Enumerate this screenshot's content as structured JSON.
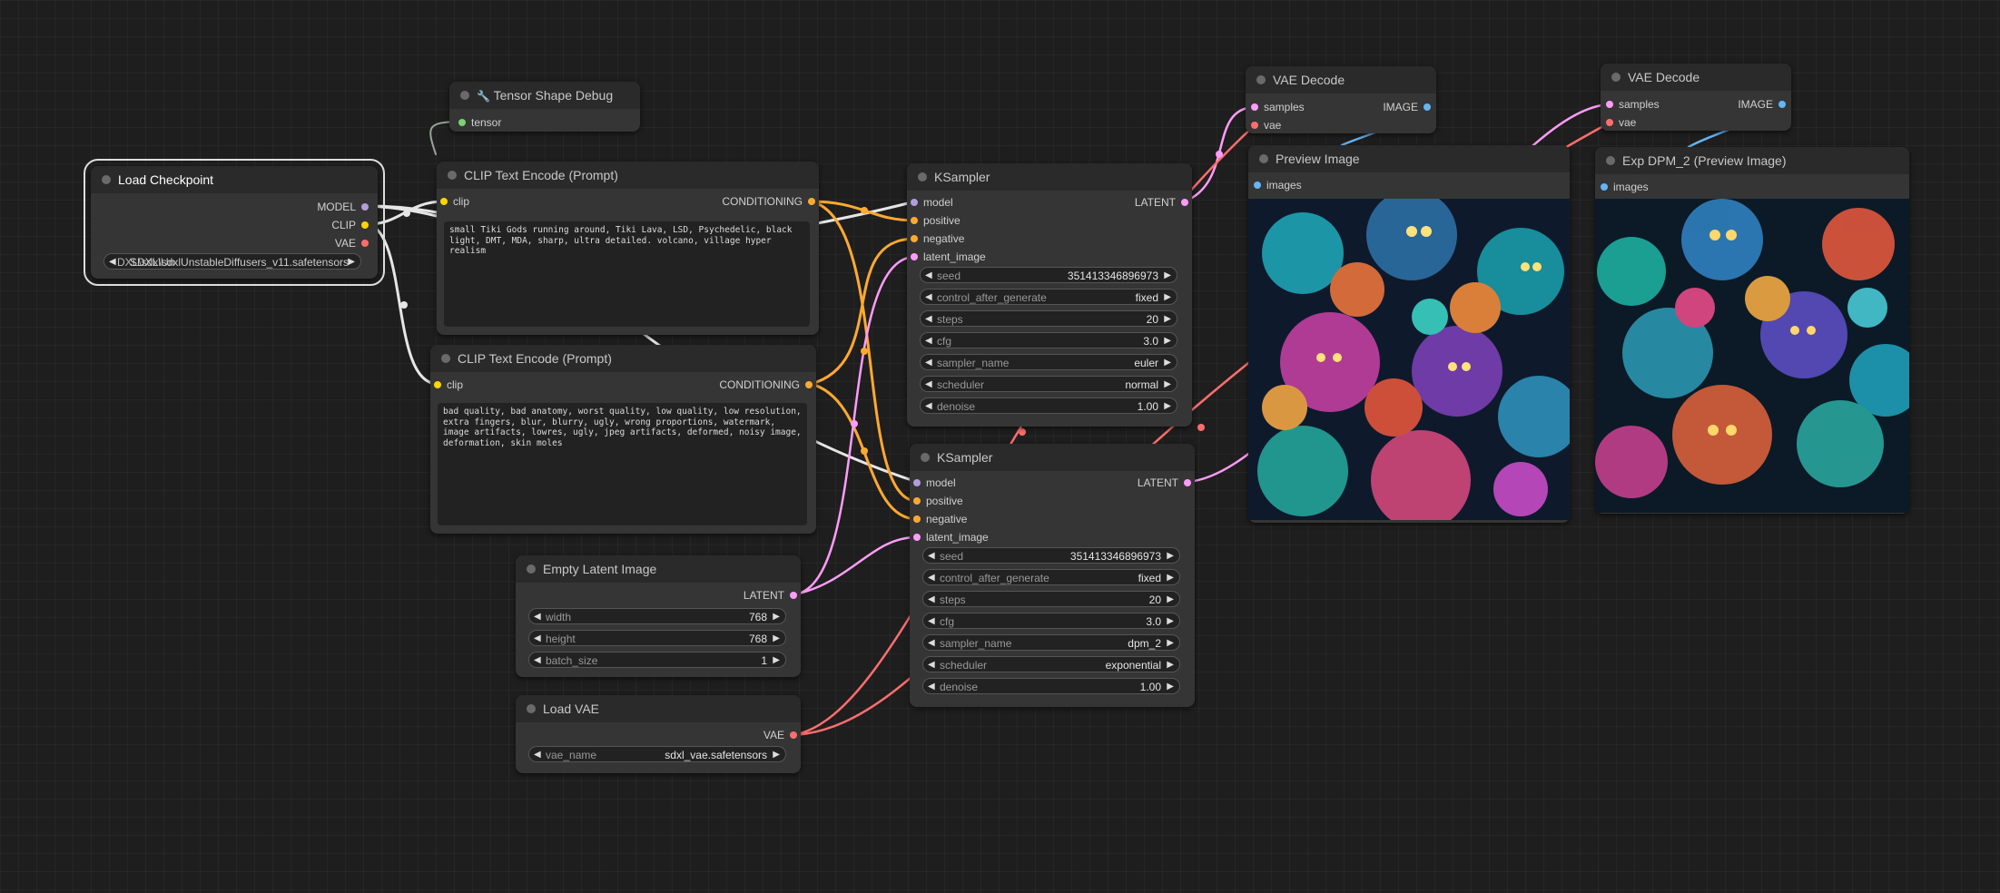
{
  "colors": {
    "model": "#b39ddb",
    "clip": "#ffd500",
    "vae": "#ff6e6e",
    "conditioning": "#ffa931",
    "latent": "#ff9cf9",
    "image": "#64b5f6",
    "tensor": "#7bd173"
  },
  "load_checkpoint": {
    "title": "Load Checkpoint",
    "outputs": [
      "MODEL",
      "CLIP",
      "VAE"
    ],
    "ckpt_name": "SDXL\\sdxlUnstableDiffusers_v11.safetensors",
    "ckpt_overlap": "DXL\\sdxlUn"
  },
  "tensor_debug": {
    "title": "Tensor Shape Debug",
    "icon": "wrench-icon",
    "input": "tensor"
  },
  "clip_pos": {
    "title": "CLIP Text Encode (Prompt)",
    "input": "clip",
    "output": "CONDITIONING",
    "text": "small Tiki Gods running around, Tiki Lava, LSD, Psychedelic, black light, DMT, MDA, sharp, ultra detailed. volcano, village hyper realism"
  },
  "clip_neg": {
    "title": "CLIP Text Encode (Prompt)",
    "input": "clip",
    "output": "CONDITIONING",
    "text": "bad quality, bad anatomy, worst quality, low quality, low resolution, extra fingers, blur, blurry, ugly, wrong proportions, watermark, image artifacts, lowres, ugly, jpeg artifacts, deformed, noisy image, deformation, skin moles"
  },
  "empty_latent": {
    "title": "Empty Latent Image",
    "output": "LATENT",
    "widgets": [
      {
        "label": "width",
        "value": "768"
      },
      {
        "label": "height",
        "value": "768"
      },
      {
        "label": "batch_size",
        "value": "1"
      }
    ]
  },
  "load_vae": {
    "title": "Load VAE",
    "output": "VAE",
    "widgets": [
      {
        "label": "vae_name",
        "value": "sdxl_vae.safetensors"
      }
    ]
  },
  "ksampler1": {
    "title": "KSampler",
    "inputs": [
      "model",
      "positive",
      "negative",
      "latent_image"
    ],
    "output": "LATENT",
    "widgets": [
      {
        "label": "seed",
        "value": "351413346896973"
      },
      {
        "label": "control_after_generate",
        "value": "fixed"
      },
      {
        "label": "steps",
        "value": "20"
      },
      {
        "label": "cfg",
        "value": "3.0"
      },
      {
        "label": "sampler_name",
        "value": "euler"
      },
      {
        "label": "scheduler",
        "value": "normal"
      },
      {
        "label": "denoise",
        "value": "1.00"
      }
    ]
  },
  "ksampler2": {
    "title": "KSampler",
    "inputs": [
      "model",
      "positive",
      "negative",
      "latent_image"
    ],
    "output": "LATENT",
    "widgets": [
      {
        "label": "seed",
        "value": "351413346896973"
      },
      {
        "label": "control_after_generate",
        "value": "fixed"
      },
      {
        "label": "steps",
        "value": "20"
      },
      {
        "label": "cfg",
        "value": "3.0"
      },
      {
        "label": "sampler_name",
        "value": "dpm_2"
      },
      {
        "label": "scheduler",
        "value": "exponential"
      },
      {
        "label": "denoise",
        "value": "1.00"
      }
    ]
  },
  "vae_decode1": {
    "title": "VAE Decode",
    "inputs": [
      "samples",
      "vae"
    ],
    "output": "IMAGE"
  },
  "vae_decode2": {
    "title": "VAE Decode",
    "inputs": [
      "samples",
      "vae"
    ],
    "output": "IMAGE"
  },
  "preview1": {
    "title": "Preview Image",
    "input": "images"
  },
  "preview2": {
    "title": "Exp DPM_2 (Preview Image)",
    "input": "images"
  }
}
